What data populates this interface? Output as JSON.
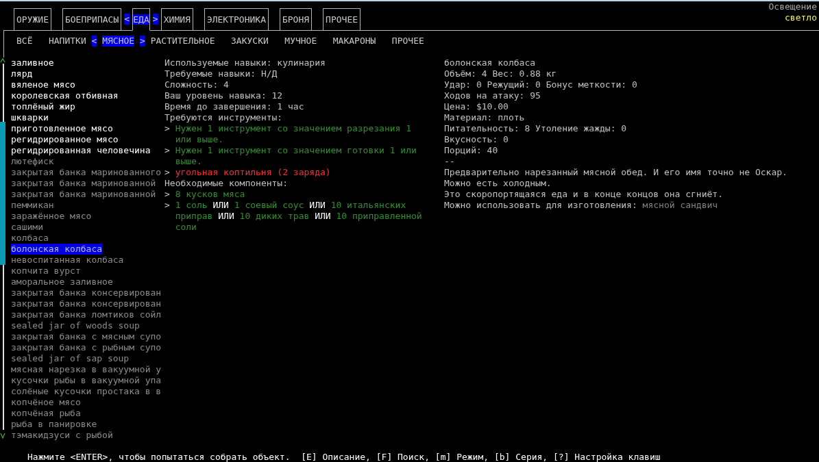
{
  "category_tabs": {
    "left_marker": "<",
    "right_marker": ">",
    "items": [
      {
        "label": "ОРУЖИЕ",
        "selected": false
      },
      {
        "label": "БОЕПРИПАСЫ",
        "selected": false
      },
      {
        "label": "ЕДА",
        "selected": true
      },
      {
        "label": "ХИМИЯ",
        "selected": false
      },
      {
        "label": "ЭЛЕКТРОНИКА",
        "selected": false
      },
      {
        "label": "БРОНЯ",
        "selected": false
      },
      {
        "label": "ПРОЧЕЕ",
        "selected": false
      }
    ]
  },
  "lighting": {
    "label": "Освещение",
    "value": "светло"
  },
  "subcategory_tabs": {
    "left_marker": "<",
    "right_marker": ">",
    "items": [
      {
        "label": "ВСЁ",
        "selected": false
      },
      {
        "label": "НАПИТКИ",
        "selected": false
      },
      {
        "label": "МЯСНОЕ",
        "selected": true
      },
      {
        "label": "РАСТИТЕЛЬНОЕ",
        "selected": false
      },
      {
        "label": "ЗАКУСКИ",
        "selected": false
      },
      {
        "label": "МУЧНОЕ",
        "selected": false
      },
      {
        "label": "МАКАРОНЫ",
        "selected": false
      },
      {
        "label": "ПРОЧЕЕ",
        "selected": false
      }
    ]
  },
  "recipes": [
    {
      "name": "заливное",
      "available": true,
      "selected": false
    },
    {
      "name": "лярд",
      "available": true,
      "selected": false
    },
    {
      "name": "вяленое мясо",
      "available": true,
      "selected": false
    },
    {
      "name": "королевская отбивная",
      "available": true,
      "selected": false
    },
    {
      "name": "топлёный жир",
      "available": true,
      "selected": false
    },
    {
      "name": "шкварки",
      "available": true,
      "selected": false
    },
    {
      "name": "приготовленное мясо",
      "available": true,
      "selected": false
    },
    {
      "name": "регидрированное мясо",
      "available": true,
      "selected": false
    },
    {
      "name": "регидрированная человечина",
      "available": true,
      "selected": false
    },
    {
      "name": "лютефиск",
      "available": false,
      "selected": false
    },
    {
      "name": "закрытая банка маринованного",
      "available": false,
      "selected": false
    },
    {
      "name": "закрытая банка маринованной",
      "available": false,
      "selected": false
    },
    {
      "name": "закрытая банка маринованной",
      "available": false,
      "selected": false
    },
    {
      "name": "пеммикан",
      "available": false,
      "selected": false
    },
    {
      "name": "заражённое мясо",
      "available": false,
      "selected": false
    },
    {
      "name": "сашими",
      "available": false,
      "selected": false
    },
    {
      "name": "колбаса",
      "available": false,
      "selected": false
    },
    {
      "name": "болонская колбаса",
      "available": false,
      "selected": true
    },
    {
      "name": "невоспитанная колбаса",
      "available": false,
      "selected": false
    },
    {
      "name": "копчита вурст",
      "available": false,
      "selected": false
    },
    {
      "name": "аморальное заливное",
      "available": false,
      "selected": false
    },
    {
      "name": "закрытая банка консервирован",
      "available": false,
      "selected": false
    },
    {
      "name": "закрытая банка консервирован",
      "available": false,
      "selected": false
    },
    {
      "name": "закрытая банка ломтиков сойл",
      "available": false,
      "selected": false
    },
    {
      "name": "sealed jar of woods soup",
      "available": false,
      "selected": false
    },
    {
      "name": "закрытая банка с мясным супо",
      "available": false,
      "selected": false
    },
    {
      "name": "закрытая банка с рыбным супо",
      "available": false,
      "selected": false
    },
    {
      "name": "sealed jar of sap soup",
      "available": false,
      "selected": false
    },
    {
      "name": "мясная нарезка в вакуумной у",
      "available": false,
      "selected": false
    },
    {
      "name": "кусочки рыбы в вакуумной упа",
      "available": false,
      "selected": false
    },
    {
      "name": "солёные кусочки простака в в",
      "available": false,
      "selected": false
    },
    {
      "name": "копчёное мясо",
      "available": false,
      "selected": false
    },
    {
      "name": "копчёная рыба",
      "available": false,
      "selected": false
    },
    {
      "name": "рыба в панировке",
      "available": false,
      "selected": false
    },
    {
      "name": "тэмакидзуси с рыбой",
      "available": false,
      "selected": false
    }
  ],
  "recipe_details": {
    "info": [
      "Используемые навыки: кулинария",
      "Требуемые навыки: Н/Д",
      "Сложность: 4",
      "Ваш уровень навыка: 12",
      "Время до завершения: 1 час"
    ],
    "tools_heading": "Требуются инструменты:",
    "tools": [
      {
        "bullet": ">",
        "segments": [
          {
            "text": "Нужен 1 инструмент со значением разрезания 1 или выше.",
            "kind": "available"
          }
        ]
      },
      {
        "bullet": ">",
        "segments": [
          {
            "text": "Нужен 1 инструмент со значением готовки 1 или выше.",
            "kind": "available"
          }
        ]
      },
      {
        "bullet": ">",
        "segments": [
          {
            "text": "угольная коптильня (2 заряда)",
            "kind": "missing"
          }
        ]
      }
    ],
    "components_heading": "Необходимые компоненты:",
    "components": [
      {
        "bullet": ">",
        "segments": [
          {
            "text": "8 кусков мяса",
            "kind": "available"
          }
        ]
      },
      {
        "bullet": ">",
        "segments": [
          {
            "text": "1 соль",
            "kind": "available"
          },
          {
            "text": "ИЛИ",
            "kind": "separator"
          },
          {
            "text": "1 соевый соус",
            "kind": "available"
          },
          {
            "text": "ИЛИ",
            "kind": "separator"
          },
          {
            "text": "10 итальянских приправ",
            "kind": "available"
          },
          {
            "text": "ИЛИ",
            "kind": "separator"
          },
          {
            "text": "10 диких трав",
            "kind": "available"
          },
          {
            "text": "ИЛИ",
            "kind": "separator"
          },
          {
            "text": "10 приправленной соли",
            "kind": "available"
          }
        ]
      }
    ]
  },
  "item_info": {
    "lines": [
      "болонская колбаса",
      "Объём: 4 Вес: 0.88 кг",
      "Удар: 0 Режущий: 0 Бонус меткости: 0",
      "Ходов на атаку: 95",
      "Цена: $10.00",
      "Материал: плоть",
      "Питательность: 8 Утоление жажды: 0",
      "Вкусность: 0",
      "Порций: 40",
      "--",
      "Предварительно нарезанный мясной обед. И его имя точно не Оскар.",
      "Можно есть холодным.",
      "Это скоропортящаяся еда и в конце концов она сгниёт."
    ],
    "uses": [
      {
        "text": "Можно использовать для изготовления:",
        "kind": "plain"
      },
      {
        "text": "мясной сандвич",
        "kind": "dim"
      }
    ]
  },
  "hint": "Нажмите <ENTER>, чтобы попытаться собрать объект.  [E] Описание, [F] Поиск, [m] Режим, [b] Серия, [?] Настройка клавиш"
}
